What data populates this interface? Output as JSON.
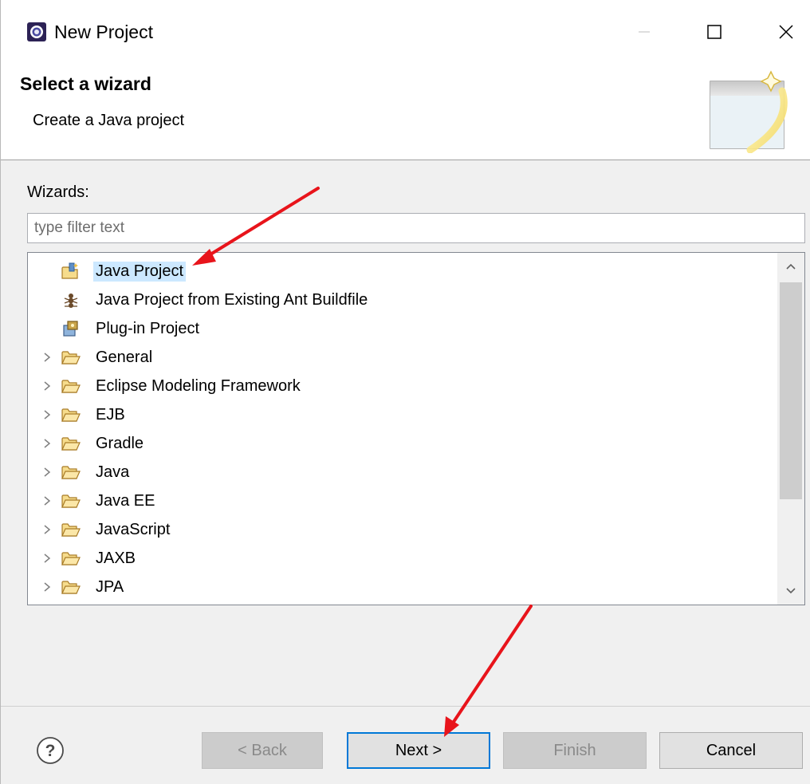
{
  "window": {
    "title": "New Project"
  },
  "banner": {
    "title": "Select a wizard",
    "description": "Create a Java project"
  },
  "wizards": {
    "label": "Wizards:",
    "filter_placeholder": "type filter text",
    "filter_value": ""
  },
  "tree": {
    "items": [
      {
        "label": "Java Project",
        "icon": "java-project-icon",
        "expandable": false,
        "selected": true
      },
      {
        "label": "Java Project from Existing Ant Buildfile",
        "icon": "ant-icon",
        "expandable": false,
        "selected": false
      },
      {
        "label": "Plug-in Project",
        "icon": "plugin-project-icon",
        "expandable": false,
        "selected": false
      },
      {
        "label": "General",
        "icon": "folder-icon",
        "expandable": true,
        "selected": false
      },
      {
        "label": "Eclipse Modeling Framework",
        "icon": "folder-icon",
        "expandable": true,
        "selected": false
      },
      {
        "label": "EJB",
        "icon": "folder-icon",
        "expandable": true,
        "selected": false
      },
      {
        "label": "Gradle",
        "icon": "folder-icon",
        "expandable": true,
        "selected": false
      },
      {
        "label": "Java",
        "icon": "folder-icon",
        "expandable": true,
        "selected": false
      },
      {
        "label": "Java EE",
        "icon": "folder-icon",
        "expandable": true,
        "selected": false
      },
      {
        "label": "JavaScript",
        "icon": "folder-icon",
        "expandable": true,
        "selected": false
      },
      {
        "label": "JAXB",
        "icon": "folder-icon",
        "expandable": true,
        "selected": false
      },
      {
        "label": "JPA",
        "icon": "folder-icon",
        "expandable": true,
        "selected": false
      }
    ]
  },
  "footer": {
    "back_label": "< Back",
    "next_label": "Next >",
    "finish_label": "Finish",
    "cancel_label": "Cancel"
  },
  "colors": {
    "selection": "#cce8ff",
    "focus_border": "#0078d7",
    "annotation_arrow": "#e8141b"
  }
}
